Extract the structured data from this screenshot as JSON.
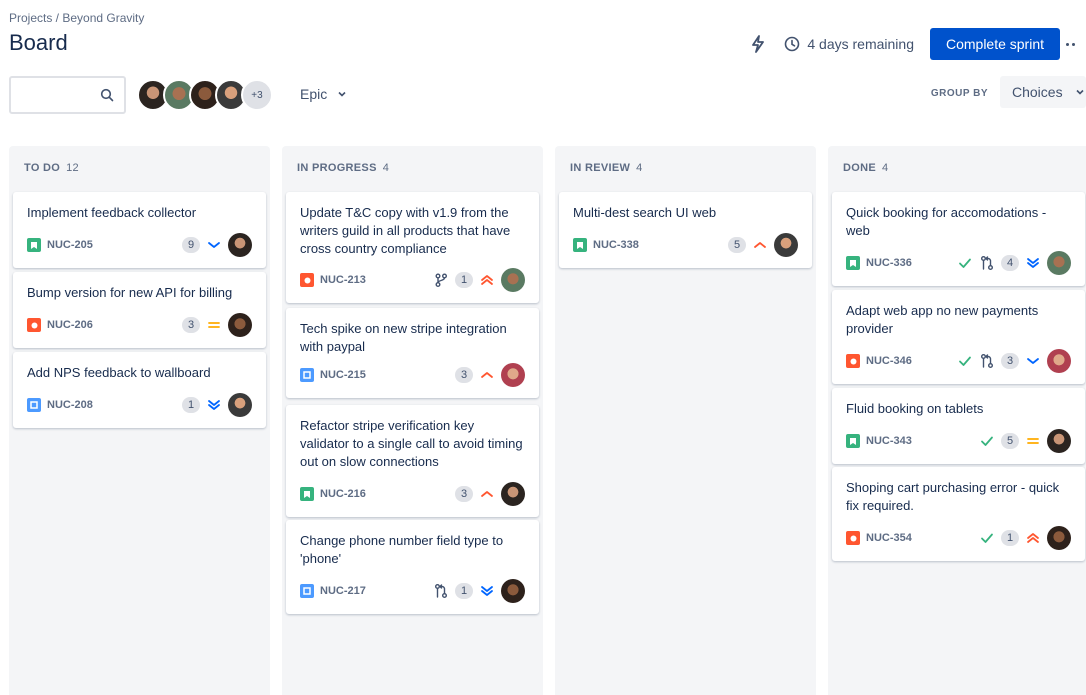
{
  "breadcrumb": "Projects / Beyond Gravity",
  "title": "Board",
  "header": {
    "remaining": "4 days remaining",
    "complete_label": "Complete sprint"
  },
  "toolbar": {
    "avatar_more": "+3",
    "epic_label": "Epic",
    "groupby_label": "GROUP BY",
    "groupby_value": "Choices"
  },
  "columns": [
    {
      "title": "TO DO",
      "count": "12",
      "cards": [
        {
          "title": "Implement feedback collector",
          "key": "NUC-205",
          "type": "story",
          "points": "9",
          "priority": "low"
        },
        {
          "title": "Bump version for new API for billing",
          "key": "NUC-206",
          "type": "bug",
          "points": "3",
          "priority": "medium"
        },
        {
          "title": "Add NPS feedback to wallboard",
          "key": "NUC-208",
          "type": "task",
          "points": "1",
          "priority": "lowest"
        }
      ]
    },
    {
      "title": "IN PROGRESS",
      "count": "4",
      "cards": [
        {
          "title": "Update T&C copy with v1.9 from the writers guild in all products that have cross country compliance",
          "key": "NUC-213",
          "type": "bug",
          "points": "1",
          "priority": "highest"
        },
        {
          "title": "Tech spike on new stripe integration with paypal",
          "key": "NUC-215",
          "type": "task",
          "points": "3",
          "priority": "high"
        },
        {
          "title": "Refactor stripe verification key validator to a single call to avoid timing out on slow connections",
          "key": "NUC-216",
          "type": "story",
          "points": "3",
          "priority": "high"
        },
        {
          "title": "Change phone number field type to 'phone'",
          "key": "NUC-217",
          "type": "task",
          "points": "1",
          "priority": "lowest"
        }
      ]
    },
    {
      "title": "IN REVIEW",
      "count": "4",
      "cards": [
        {
          "title": "Multi-dest search UI web",
          "key": "NUC-338",
          "type": "story",
          "points": "5",
          "priority": "high"
        }
      ]
    },
    {
      "title": "DONE",
      "count": "4",
      "cards": [
        {
          "title": "Quick booking for accomodations - web",
          "key": "NUC-336",
          "type": "story",
          "points": "4",
          "priority": "lowest"
        },
        {
          "title": "Adapt web app no new payments provider",
          "key": "NUC-346",
          "type": "bug",
          "points": "3",
          "priority": "low"
        },
        {
          "title": "Fluid booking on tablets",
          "key": "NUC-343",
          "type": "story",
          "points": "5",
          "priority": "medium"
        },
        {
          "title": "Shoping cart purchasing error - quick fix required.",
          "key": "NUC-354",
          "type": "bug",
          "points": "1",
          "priority": "highest"
        }
      ]
    }
  ],
  "colors": {
    "primary": "#0052cc",
    "story": "#36b37e",
    "bug": "#ff5630",
    "task": "#4c9aff",
    "done_check": "#36b37e",
    "priority_high": "#ff5630",
    "priority_medium": "#ffab00",
    "priority_low": "#0065ff"
  }
}
